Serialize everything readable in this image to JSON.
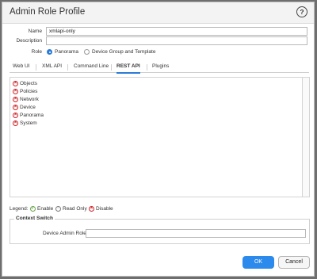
{
  "dialog": {
    "title": "Admin Role Profile",
    "help_icon": "?"
  },
  "form": {
    "name_label": "Name",
    "name_value": "xmlapi-only",
    "description_label": "Description",
    "description_value": "",
    "role_label": "Role",
    "role_options": [
      {
        "label": "Panorama",
        "selected": true
      },
      {
        "label": "Device Group and Template",
        "selected": false
      }
    ]
  },
  "tabs": [
    "Web UI",
    "XML API",
    "Command Line",
    "REST API",
    "Plugins"
  ],
  "active_tab": "REST API",
  "permissions": [
    {
      "label": "Objects",
      "icon": "disable-icon"
    },
    {
      "label": "Policies",
      "icon": "disable-icon"
    },
    {
      "label": "Network",
      "icon": "disable-icon"
    },
    {
      "label": "Device",
      "icon": "disable-icon"
    },
    {
      "label": "Panorama",
      "icon": "disable-icon"
    },
    {
      "label": "System",
      "icon": "disable-icon"
    }
  ],
  "legend": {
    "label": "Legend:",
    "enable": "Enable",
    "read_only": "Read Only",
    "disable": "Disable"
  },
  "context_switch": {
    "title": "Context Switch",
    "device_admin_role_label": "Device Admin Role",
    "device_admin_role_value": ""
  },
  "buttons": {
    "ok": "OK",
    "cancel": "Cancel"
  },
  "colors": {
    "accent": "#2b7bd6",
    "ok_button": "#2b8aeb",
    "disable": "#d2232a",
    "enable": "#6aa84f"
  }
}
